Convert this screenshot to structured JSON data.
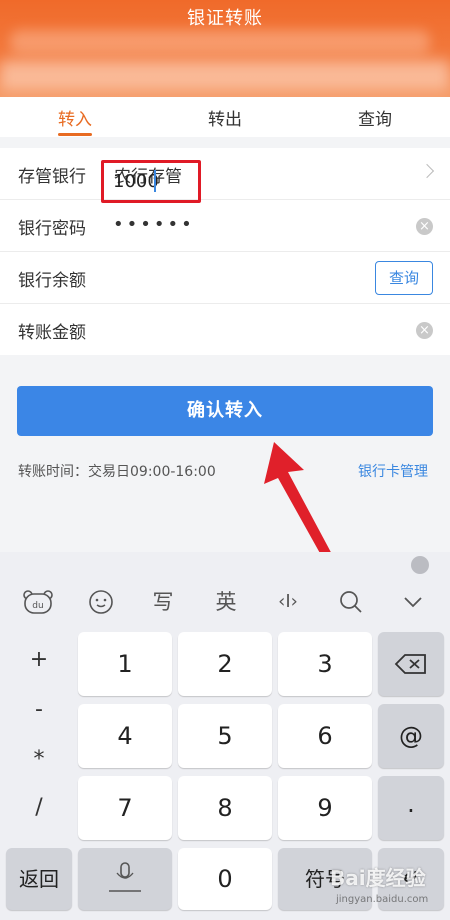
{
  "header": {
    "title": "银证转账"
  },
  "tabs": [
    {
      "label": "转入"
    },
    {
      "label": "转出"
    },
    {
      "label": "查询"
    }
  ],
  "form": {
    "bank": {
      "label": "存管银行",
      "value": "农行存管"
    },
    "password": {
      "label": "银行密码",
      "value": "••••••"
    },
    "balance": {
      "label": "银行余额",
      "button": "查询"
    },
    "amount": {
      "label": "转账金额",
      "value": "1000"
    }
  },
  "confirm_button": "确认转入",
  "time_info": "转账时间：交易日09:00-16:00",
  "card_mgmt": "银行卡管理",
  "toolbar": {
    "write": "写",
    "english": "英",
    "cursor": "‹I›",
    "search": "⌕",
    "collapse": "⌄"
  },
  "keys": {
    "plus": "+",
    "minus": "-",
    "star": "*",
    "slash": "/",
    "k1": "1",
    "k2": "2",
    "k3": "3",
    "k4": "4",
    "k5": "5",
    "k6": "6",
    "k7": "7",
    "k8": "8",
    "k9": "9",
    "k0": "0",
    "backspace": "⌫",
    "at": "@",
    "dot": ".",
    "back": "返回",
    "symbol": "符号",
    "enter": "↵"
  },
  "watermark": "Bai度经验",
  "watermark_sub": "jingyan.baidu.com"
}
